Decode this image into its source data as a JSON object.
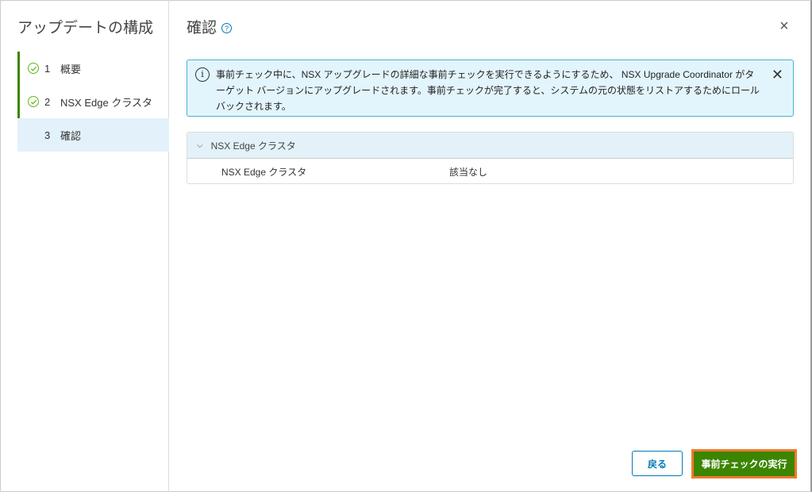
{
  "sidebar": {
    "title": "アップデートの構成",
    "steps": [
      {
        "num": "1",
        "label": "概要"
      },
      {
        "num": "2",
        "label": "NSX Edge クラスタ"
      },
      {
        "num": "3",
        "label": "確認"
      }
    ]
  },
  "main": {
    "title": "確認",
    "help": "?",
    "close": "×",
    "alert": {
      "text": "事前チェック中に、NSX アップグレードの詳細な事前チェックを実行できるようにするため、 NSX Upgrade Coordinator がターゲット バージョンにアップグレードされます。事前チェックが完了すると、システムの元の状態をリストアするためにロールバックされます。",
      "close": "✕"
    },
    "table": {
      "group": "NSX Edge クラスタ",
      "rows": [
        {
          "name": "NSX Edge クラスタ",
          "value": "該当なし"
        }
      ]
    }
  },
  "footer": {
    "back": "戻る",
    "run": "事前チェックの実行"
  }
}
